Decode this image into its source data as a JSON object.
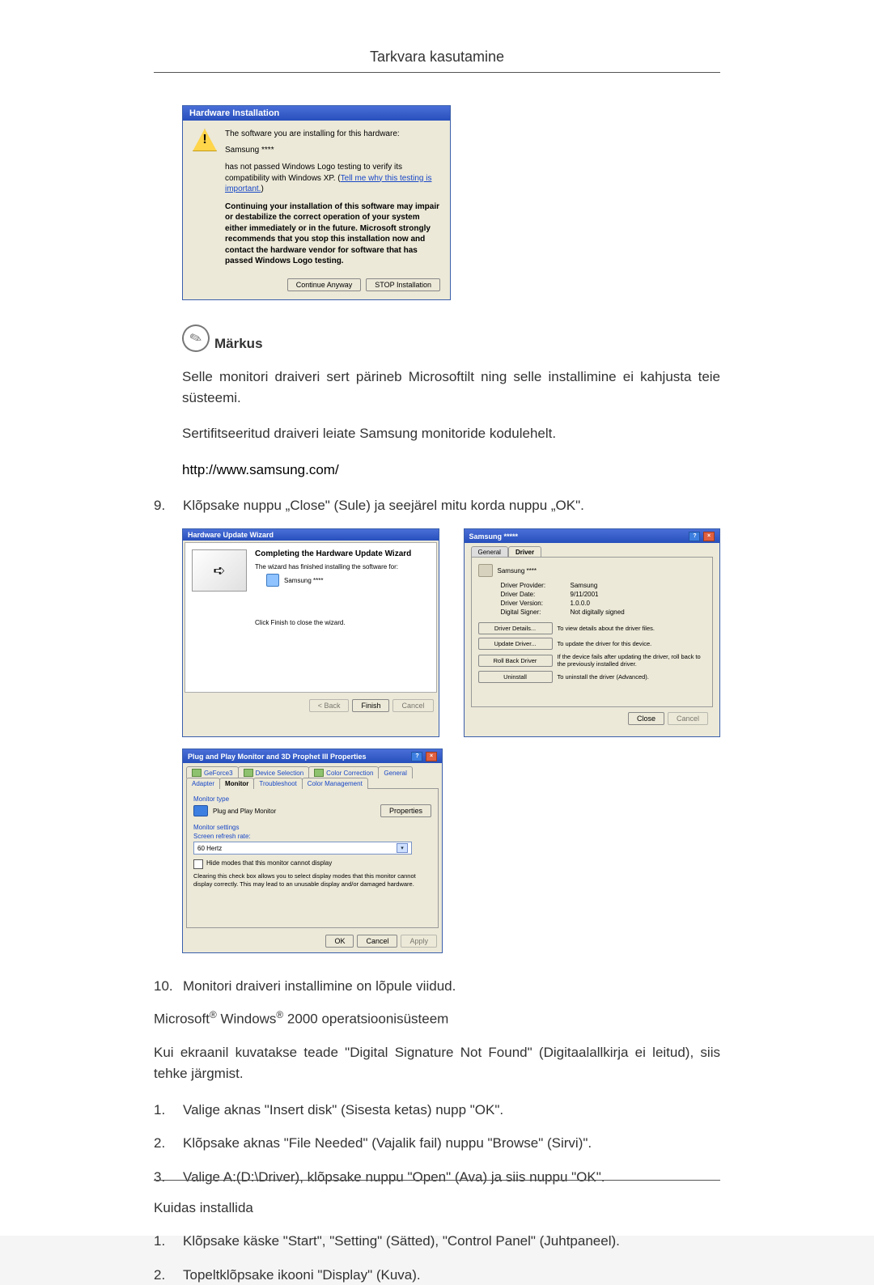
{
  "header": {
    "title": "Tarkvara kasutamine"
  },
  "dlg1": {
    "title": "Hardware Installation",
    "line1": "The software you are installing for this hardware:",
    "product": "Samsung ****",
    "logo1": "has not passed Windows Logo testing to verify its compatibility with Windows XP. (",
    "logo_link": "Tell me why this testing is important.",
    "logo2": ")",
    "warn": "Continuing your installation of this software may impair or destabilize the correct operation of your system either immediately or in the future. Microsoft strongly recommends that you stop this installation now and contact the hardware vendor for software that has passed Windows Logo testing.",
    "btn_continue": "Continue Anyway",
    "btn_stop": "STOP Installation"
  },
  "note": {
    "label": "Märkus",
    "p1": "Selle monitori draiveri sert pärineb Microsoftilt ning selle installimine ei kahjusta teie süsteemi.",
    "p2": "Sertifitseeritud draiveri leiate Samsung monitoride kodulehelt.",
    "url": "http://www.samsung.com/"
  },
  "steps_top": {
    "s9_num": "9.",
    "s9": "Klõpsake nuppu „Close\" (Sule) ja seejärel mitu korda nuppu „OK\"."
  },
  "wizard": {
    "title": "Hardware Update Wizard",
    "heading": "Completing the Hardware Update Wizard",
    "line1": "The wizard has finished installing the software for:",
    "product": "Samsung ****",
    "finish_hint": "Click Finish to close the wizard.",
    "btn_back": "< Back",
    "btn_finish": "Finish",
    "btn_cancel": "Cancel"
  },
  "driver_props": {
    "title": "Samsung *****",
    "tab_general": "General",
    "tab_driver": "Driver",
    "device": "Samsung ****",
    "provider_k": "Driver Provider:",
    "provider_v": "Samsung",
    "date_k": "Driver Date:",
    "date_v": "9/11/2001",
    "ver_k": "Driver Version:",
    "ver_v": "1.0.0.0",
    "signer_k": "Digital Signer:",
    "signer_v": "Not digitally signed",
    "btn_details": "Driver Details...",
    "desc_details": "To view details about the driver files.",
    "btn_update": "Update Driver...",
    "desc_update": "To update the driver for this device.",
    "btn_rollback": "Roll Back Driver",
    "desc_rollback": "If the device fails after updating the driver, roll back to the previously installed driver.",
    "btn_uninstall": "Uninstall",
    "desc_uninstall": "To uninstall the driver (Advanced).",
    "btn_close": "Close",
    "btn_cancel": "Cancel"
  },
  "monitor_props": {
    "title": "Plug and Play Monitor and 3D Prophet III Properties",
    "tabs": [
      "GeForce3",
      "Device Selection",
      "Color Correction",
      "General",
      "Adapter",
      "Monitor",
      "Troubleshoot",
      "Color Management"
    ],
    "active_tab": "Monitor",
    "type_h": "Monitor type",
    "type_v": "Plug and Play Monitor",
    "btn_props": "Properties",
    "settings_h": "Monitor settings",
    "refresh_h": "Screen refresh rate:",
    "refresh_v": "60 Hertz",
    "hide_chk": "Hide modes that this monitor cannot display",
    "hide_hint": "Clearing this check box allows you to select display modes that this monitor cannot display correctly. This may lead to an unusable display and/or damaged hardware.",
    "btn_ok": "OK",
    "btn_cancel": "Cancel",
    "btn_apply": "Apply"
  },
  "after_shots": {
    "s10_num": "10.",
    "s10": "Monitori draiveri installimine on lõpule viidud.",
    "os_line_pre": "Microsoft",
    "os_line_mid": " Windows",
    "os_line_post": " 2000 operatsioonisüsteem",
    "dig_sig": "Kui ekraanil kuvatakse teade \"Digital Signature Not Found\" (Digitaalallkirja ei leitud), siis tehke järgmist.",
    "a1_num": "1.",
    "a1": "Valige aknas \"Insert disk\" (Sisesta ketas) nupp \"OK\".",
    "a2_num": "2.",
    "a2": "Klõpsake aknas \"File Needed\" (Vajalik fail) nuppu \"Browse\" (Sirvi)\".",
    "a3_num": "3.",
    "a3": "Valige A:(D:\\Driver), klõpsake nuppu \"Open\" (Ava) ja siis nuppu \"OK\".",
    "howto_h": "Kuidas installida",
    "b1_num": "1.",
    "b1": "Klõpsake käske \"Start\", \"Setting\" (Sätted), \"Control Panel\" (Juhtpaneel).",
    "b2_num": "2.",
    "b2": "Topeltklõpsake ikooni \"Display\" (Kuva)."
  }
}
